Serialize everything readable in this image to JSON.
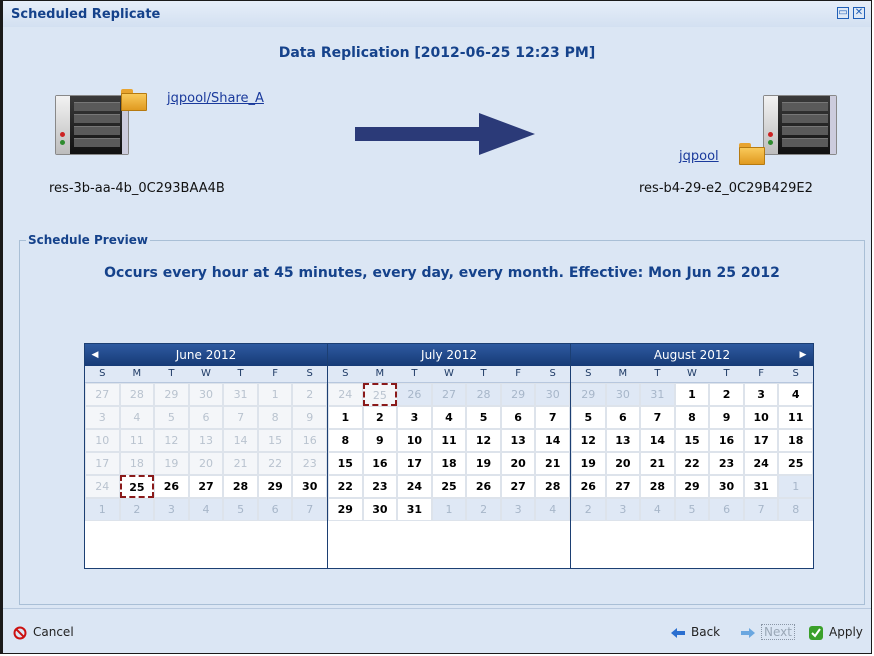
{
  "window": {
    "title": "Scheduled Replicate"
  },
  "header": {
    "title": "Data Replication [2012-06-25 12:23 PM]"
  },
  "source": {
    "path": "jqpool/Share_A",
    "host": "res-3b-aa-4b_0C293BAA4B"
  },
  "target": {
    "path": "jqpool",
    "host": "res-b4-29-e2_0C29B429E2"
  },
  "preview": {
    "legend": "Schedule Preview",
    "summary": "Occurs every hour at 45 minutes, every day, every month. Effective: Mon Jun 25 2012"
  },
  "calendar": {
    "weekdays": [
      "S",
      "M",
      "T",
      "W",
      "T",
      "F",
      "S"
    ],
    "months": [
      {
        "name": "June 2012",
        "weeks": [
          [
            {
              "d": "27",
              "s": "dis"
            },
            {
              "d": "28",
              "s": "dis"
            },
            {
              "d": "29",
              "s": "dis"
            },
            {
              "d": "30",
              "s": "dis"
            },
            {
              "d": "31",
              "s": "dis"
            },
            {
              "d": "1",
              "s": "dis"
            },
            {
              "d": "2",
              "s": "dis"
            }
          ],
          [
            {
              "d": "3",
              "s": "dis"
            },
            {
              "d": "4",
              "s": "dis"
            },
            {
              "d": "5",
              "s": "dis"
            },
            {
              "d": "6",
              "s": "dis"
            },
            {
              "d": "7",
              "s": "dis"
            },
            {
              "d": "8",
              "s": "dis"
            },
            {
              "d": "9",
              "s": "dis"
            }
          ],
          [
            {
              "d": "10",
              "s": "dis"
            },
            {
              "d": "11",
              "s": "dis"
            },
            {
              "d": "12",
              "s": "dis"
            },
            {
              "d": "13",
              "s": "dis"
            },
            {
              "d": "14",
              "s": "dis"
            },
            {
              "d": "15",
              "s": "dis"
            },
            {
              "d": "16",
              "s": "dis"
            }
          ],
          [
            {
              "d": "17",
              "s": "dis"
            },
            {
              "d": "18",
              "s": "dis"
            },
            {
              "d": "19",
              "s": "dis"
            },
            {
              "d": "20",
              "s": "dis"
            },
            {
              "d": "21",
              "s": "dis"
            },
            {
              "d": "22",
              "s": "dis"
            },
            {
              "d": "23",
              "s": "dis"
            }
          ],
          [
            {
              "d": "24",
              "s": "dis"
            },
            {
              "d": "25",
              "s": "today"
            },
            {
              "d": "26",
              "s": ""
            },
            {
              "d": "27",
              "s": ""
            },
            {
              "d": "28",
              "s": ""
            },
            {
              "d": "29",
              "s": ""
            },
            {
              "d": "30",
              "s": ""
            }
          ],
          [
            {
              "d": "1",
              "s": "next"
            },
            {
              "d": "2",
              "s": "next"
            },
            {
              "d": "3",
              "s": "next"
            },
            {
              "d": "4",
              "s": "next"
            },
            {
              "d": "5",
              "s": "next"
            },
            {
              "d": "6",
              "s": "next"
            },
            {
              "d": "7",
              "s": "next"
            }
          ]
        ]
      },
      {
        "name": "July 2012",
        "weeks": [
          [
            {
              "d": "24",
              "s": "dis"
            },
            {
              "d": "25",
              "s": "dis today"
            },
            {
              "d": "26",
              "s": "next"
            },
            {
              "d": "27",
              "s": "next"
            },
            {
              "d": "28",
              "s": "next"
            },
            {
              "d": "29",
              "s": "next"
            },
            {
              "d": "30",
              "s": "next"
            }
          ],
          [
            {
              "d": "1",
              "s": ""
            },
            {
              "d": "2",
              "s": ""
            },
            {
              "d": "3",
              "s": ""
            },
            {
              "d": "4",
              "s": ""
            },
            {
              "d": "5",
              "s": ""
            },
            {
              "d": "6",
              "s": ""
            },
            {
              "d": "7",
              "s": ""
            }
          ],
          [
            {
              "d": "8",
              "s": ""
            },
            {
              "d": "9",
              "s": ""
            },
            {
              "d": "10",
              "s": ""
            },
            {
              "d": "11",
              "s": ""
            },
            {
              "d": "12",
              "s": ""
            },
            {
              "d": "13",
              "s": ""
            },
            {
              "d": "14",
              "s": ""
            }
          ],
          [
            {
              "d": "15",
              "s": ""
            },
            {
              "d": "16",
              "s": ""
            },
            {
              "d": "17",
              "s": ""
            },
            {
              "d": "18",
              "s": ""
            },
            {
              "d": "19",
              "s": ""
            },
            {
              "d": "20",
              "s": ""
            },
            {
              "d": "21",
              "s": ""
            }
          ],
          [
            {
              "d": "22",
              "s": ""
            },
            {
              "d": "23",
              "s": ""
            },
            {
              "d": "24",
              "s": ""
            },
            {
              "d": "25",
              "s": ""
            },
            {
              "d": "26",
              "s": ""
            },
            {
              "d": "27",
              "s": ""
            },
            {
              "d": "28",
              "s": ""
            }
          ],
          [
            {
              "d": "29",
              "s": ""
            },
            {
              "d": "30",
              "s": ""
            },
            {
              "d": "31",
              "s": ""
            },
            {
              "d": "1",
              "s": "next"
            },
            {
              "d": "2",
              "s": "next"
            },
            {
              "d": "3",
              "s": "next"
            },
            {
              "d": "4",
              "s": "next"
            }
          ]
        ]
      },
      {
        "name": "August 2012",
        "weeks": [
          [
            {
              "d": "29",
              "s": "next"
            },
            {
              "d": "30",
              "s": "next"
            },
            {
              "d": "31",
              "s": "next"
            },
            {
              "d": "1",
              "s": ""
            },
            {
              "d": "2",
              "s": ""
            },
            {
              "d": "3",
              "s": ""
            },
            {
              "d": "4",
              "s": ""
            }
          ],
          [
            {
              "d": "5",
              "s": ""
            },
            {
              "d": "6",
              "s": ""
            },
            {
              "d": "7",
              "s": ""
            },
            {
              "d": "8",
              "s": ""
            },
            {
              "d": "9",
              "s": ""
            },
            {
              "d": "10",
              "s": ""
            },
            {
              "d": "11",
              "s": ""
            }
          ],
          [
            {
              "d": "12",
              "s": ""
            },
            {
              "d": "13",
              "s": ""
            },
            {
              "d": "14",
              "s": ""
            },
            {
              "d": "15",
              "s": ""
            },
            {
              "d": "16",
              "s": ""
            },
            {
              "d": "17",
              "s": ""
            },
            {
              "d": "18",
              "s": ""
            }
          ],
          [
            {
              "d": "19",
              "s": ""
            },
            {
              "d": "20",
              "s": ""
            },
            {
              "d": "21",
              "s": ""
            },
            {
              "d": "22",
              "s": ""
            },
            {
              "d": "23",
              "s": ""
            },
            {
              "d": "24",
              "s": ""
            },
            {
              "d": "25",
              "s": ""
            }
          ],
          [
            {
              "d": "26",
              "s": ""
            },
            {
              "d": "27",
              "s": ""
            },
            {
              "d": "28",
              "s": ""
            },
            {
              "d": "29",
              "s": ""
            },
            {
              "d": "30",
              "s": ""
            },
            {
              "d": "31",
              "s": ""
            },
            {
              "d": "1",
              "s": "next"
            }
          ],
          [
            {
              "d": "2",
              "s": "next"
            },
            {
              "d": "3",
              "s": "next"
            },
            {
              "d": "4",
              "s": "next"
            },
            {
              "d": "5",
              "s": "next"
            },
            {
              "d": "6",
              "s": "next"
            },
            {
              "d": "7",
              "s": "next"
            },
            {
              "d": "8",
              "s": "next"
            }
          ]
        ]
      }
    ]
  },
  "footer": {
    "cancel": "Cancel",
    "back": "Back",
    "next": "Next",
    "apply": "Apply"
  },
  "colors": {
    "title": "#15428b",
    "link": "#1a3a9c",
    "arrow": "#2b3a78",
    "calendar_header": "#1c3f73",
    "cancel_icon": "#cc1111",
    "apply_icon": "#3aa02a"
  },
  "icons": [
    "restore-icon",
    "close-icon",
    "server-icon",
    "folder-icon",
    "arrow-right-icon",
    "cancel-icon",
    "back-arrow-icon",
    "next-arrow-icon",
    "apply-check-icon"
  ]
}
